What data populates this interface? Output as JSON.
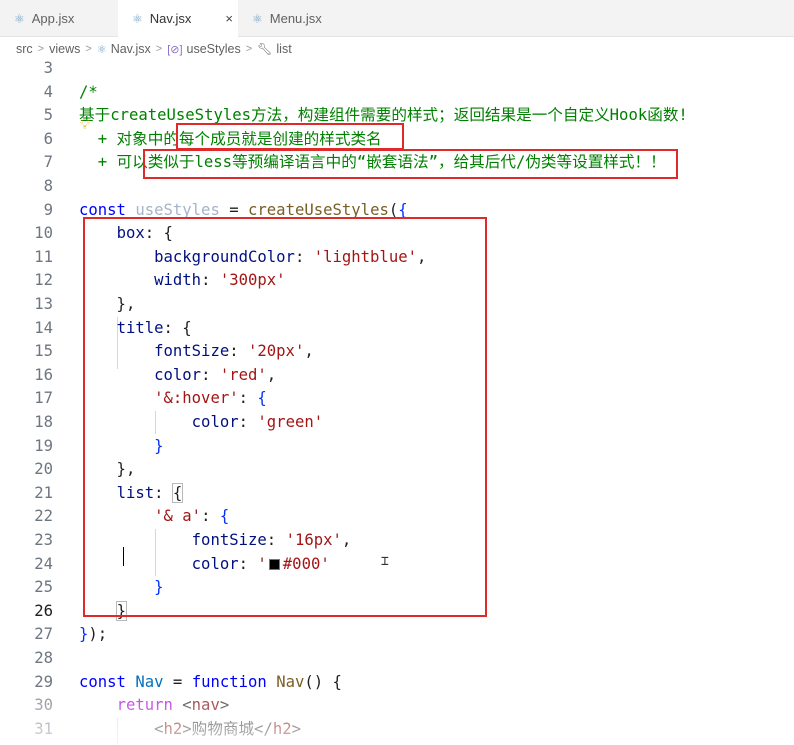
{
  "tabs": [
    {
      "label": "App.jsx",
      "active": false
    },
    {
      "label": "Nav.jsx",
      "active": true,
      "close": "×"
    },
    {
      "label": "Menu.jsx",
      "active": false
    }
  ],
  "breadcrumb": [
    "src",
    "views",
    "Nav.jsx",
    "useStyles",
    "list"
  ],
  "icons": {
    "tab_file": "react-icon",
    "breadcrumb_file": "react-icon",
    "breadcrumb_symbol": "cube-icon",
    "breadcrumb_prop": "wrench-icon",
    "lightbulb": "lightbulb-icon"
  },
  "colors": {
    "highlight_box": "#e02a2a",
    "swatch": "#000000"
  },
  "lines": [
    {
      "n": "3",
      "tokens": []
    },
    {
      "n": "4",
      "tokens": [
        {
          "c": "cmt",
          "t": "/*"
        }
      ]
    },
    {
      "n": "5",
      "tokens": [
        {
          "c": "cmt",
          "t": "基于createUseStyles方法，构建组件需要的样式；返回结果是一个自定义Hook函数!"
        }
      ]
    },
    {
      "n": "6",
      "tokens": [
        {
          "c": "cmt",
          "t": "  + 对象中的每个成员就是创建的样式类名"
        }
      ]
    },
    {
      "n": "7",
      "tokens": [
        {
          "c": "cmt",
          "t": "  + 可以类似于less等预编译语言中的“嵌套语法”，给其后代/伪类等设置样式！！"
        }
      ]
    },
    {
      "n": "8",
      "tokens": []
    },
    {
      "n": "9",
      "tokens": [
        {
          "c": "kw",
          "t": "const "
        },
        {
          "c": "dim",
          "t": "useStyles"
        },
        {
          "c": "plain",
          "t": " = "
        },
        {
          "c": "fn",
          "t": "createUseStyles"
        },
        {
          "c": "plain",
          "t": "("
        },
        {
          "c": "brk",
          "t": "{"
        }
      ]
    },
    {
      "n": "10",
      "tokens": [
        {
          "c": "plain",
          "t": "    "
        },
        {
          "c": "prop",
          "t": "box"
        },
        {
          "c": "plain",
          "t": ": {"
        }
      ]
    },
    {
      "n": "11",
      "tokens": [
        {
          "c": "plain",
          "t": "        "
        },
        {
          "c": "prop",
          "t": "backgroundColor"
        },
        {
          "c": "plain",
          "t": ": "
        },
        {
          "c": "str",
          "t": "'lightblue'"
        },
        {
          "c": "plain",
          "t": ","
        }
      ]
    },
    {
      "n": "12",
      "tokens": [
        {
          "c": "plain",
          "t": "        "
        },
        {
          "c": "prop",
          "t": "width"
        },
        {
          "c": "plain",
          "t": ": "
        },
        {
          "c": "str",
          "t": "'300px'"
        }
      ]
    },
    {
      "n": "13",
      "tokens": [
        {
          "c": "plain",
          "t": "    },"
        }
      ]
    },
    {
      "n": "14",
      "tokens": [
        {
          "c": "plain",
          "t": "    "
        },
        {
          "c": "prop",
          "t": "title"
        },
        {
          "c": "plain",
          "t": ": {"
        }
      ]
    },
    {
      "n": "15",
      "tokens": [
        {
          "c": "plain",
          "t": "        "
        },
        {
          "c": "prop",
          "t": "fontSize"
        },
        {
          "c": "plain",
          "t": ": "
        },
        {
          "c": "str",
          "t": "'20px'"
        },
        {
          "c": "plain",
          "t": ","
        }
      ]
    },
    {
      "n": "16",
      "tokens": [
        {
          "c": "plain",
          "t": "        "
        },
        {
          "c": "prop",
          "t": "color"
        },
        {
          "c": "plain",
          "t": ": "
        },
        {
          "c": "str",
          "t": "'red'"
        },
        {
          "c": "plain",
          "t": ","
        }
      ]
    },
    {
      "n": "17",
      "tokens": [
        {
          "c": "plain",
          "t": "        "
        },
        {
          "c": "str",
          "t": "'&:hover'"
        },
        {
          "c": "plain",
          "t": ": "
        },
        {
          "c": "brk",
          "t": "{"
        }
      ]
    },
    {
      "n": "18",
      "tokens": [
        {
          "c": "plain",
          "t": "            "
        },
        {
          "c": "prop",
          "t": "color"
        },
        {
          "c": "plain",
          "t": ": "
        },
        {
          "c": "str",
          "t": "'green'"
        }
      ]
    },
    {
      "n": "19",
      "tokens": [
        {
          "c": "plain",
          "t": "        "
        },
        {
          "c": "brk",
          "t": "}"
        }
      ]
    },
    {
      "n": "20",
      "tokens": [
        {
          "c": "plain",
          "t": "    },"
        }
      ]
    },
    {
      "n": "21",
      "tokens": [
        {
          "c": "plain",
          "t": "    "
        },
        {
          "c": "prop",
          "t": "list"
        },
        {
          "c": "plain",
          "t": ": "
        },
        {
          "c": "plainhl",
          "t": "{"
        }
      ]
    },
    {
      "n": "22",
      "tokens": [
        {
          "c": "plain",
          "t": "        "
        },
        {
          "c": "str",
          "t": "'& a'"
        },
        {
          "c": "plain",
          "t": ": "
        },
        {
          "c": "brk",
          "t": "{"
        }
      ]
    },
    {
      "n": "23",
      "tokens": [
        {
          "c": "plain",
          "t": "            "
        },
        {
          "c": "prop",
          "t": "fontSize"
        },
        {
          "c": "plain",
          "t": ": "
        },
        {
          "c": "str",
          "t": "'16px'"
        },
        {
          "c": "plain",
          "t": ","
        }
      ]
    },
    {
      "n": "24",
      "tokens": [
        {
          "c": "plain",
          "t": "            "
        },
        {
          "c": "prop",
          "t": "color"
        },
        {
          "c": "plain",
          "t": ": "
        },
        {
          "c": "str",
          "t": "'"
        },
        {
          "c": "swatch",
          "t": ""
        },
        {
          "c": "str",
          "t": "#000'"
        }
      ]
    },
    {
      "n": "25",
      "tokens": [
        {
          "c": "plain",
          "t": "        "
        },
        {
          "c": "brk",
          "t": "}"
        }
      ]
    },
    {
      "n": "26",
      "tokens": [
        {
          "c": "plain",
          "t": "    "
        },
        {
          "c": "plainhl",
          "t": "}"
        }
      ]
    },
    {
      "n": "27",
      "tokens": [
        {
          "c": "brk",
          "t": "}"
        },
        {
          "c": "plain",
          "t": ");"
        }
      ]
    },
    {
      "n": "28",
      "tokens": []
    },
    {
      "n": "29",
      "tokens": [
        {
          "c": "kw",
          "t": "const "
        },
        {
          "c": "var",
          "t": "Nav"
        },
        {
          "c": "plain",
          "t": " = "
        },
        {
          "c": "kw",
          "t": "function "
        },
        {
          "c": "fn",
          "t": "Nav"
        },
        {
          "c": "plain",
          "t": "() {"
        }
      ]
    },
    {
      "n": "30",
      "tokens": [
        {
          "c": "plain",
          "t": "    "
        },
        {
          "c": "ctl",
          "t": "return "
        },
        {
          "c": "plain",
          "t": "<"
        },
        {
          "c": "tag",
          "t": "nav"
        },
        {
          "c": "plain",
          "t": ">"
        }
      ]
    },
    {
      "n": "31",
      "tokens": [
        {
          "c": "plain",
          "t": "        <"
        },
        {
          "c": "tag",
          "t": "h2"
        },
        {
          "c": "plain",
          "t": ">购物商城</"
        },
        {
          "c": "tag",
          "t": "h2"
        },
        {
          "c": "plain",
          "t": ">"
        }
      ]
    }
  ],
  "current_line": "26"
}
